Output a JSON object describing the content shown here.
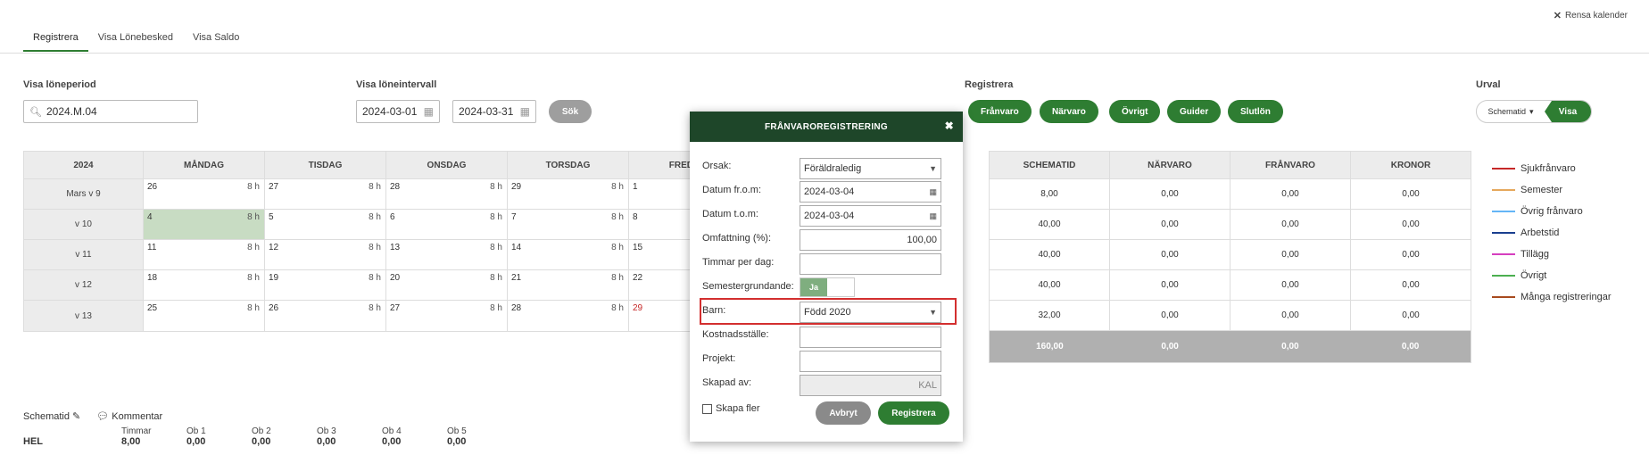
{
  "header": {
    "clear_calendar": "Rensa kalender"
  },
  "tabs": [
    "Registrera",
    "Visa Lönebesked",
    "Visa Saldo"
  ],
  "period": {
    "label": "Visa löneperiod",
    "value": "2024.M.04"
  },
  "interval": {
    "label": "Visa löneintervall",
    "from": "2024-03-01",
    "to": "2024-03-31",
    "search": "Sök"
  },
  "register": {
    "label": "Registrera",
    "buttons": [
      "Frånvaro",
      "Närvaro",
      "Övrigt",
      "Guider",
      "Slutlön"
    ]
  },
  "urval": {
    "label": "Urval",
    "select": "Schematid",
    "button": "Visa"
  },
  "calendar": {
    "year": "2024",
    "days": [
      "MÅNDAG",
      "TISDAG",
      "ONSDAG",
      "TORSDAG",
      "FRED"
    ],
    "rows": [
      {
        "week": "Mars v 9",
        "dates": [
          "26",
          "27",
          "28",
          "29",
          "1"
        ]
      },
      {
        "week": "v 10",
        "dates": [
          "4",
          "5",
          "6",
          "7",
          "8"
        ]
      },
      {
        "week": "v 11",
        "dates": [
          "11",
          "12",
          "13",
          "14",
          "15"
        ]
      },
      {
        "week": "v 12",
        "dates": [
          "18",
          "19",
          "20",
          "21",
          "22"
        ]
      },
      {
        "week": "v 13",
        "dates": [
          "25",
          "26",
          "27",
          "28",
          "29"
        ]
      }
    ],
    "hours": "8 h"
  },
  "summary": {
    "headers": [
      "SCHEMATID",
      "NÄRVARO",
      "FRÅNVARO",
      "KRONOR"
    ],
    "rows": [
      [
        "8,00",
        "0,00",
        "0,00",
        "0,00"
      ],
      [
        "40,00",
        "0,00",
        "0,00",
        "0,00"
      ],
      [
        "40,00",
        "0,00",
        "0,00",
        "0,00"
      ],
      [
        "40,00",
        "0,00",
        "0,00",
        "0,00"
      ],
      [
        "32,00",
        "0,00",
        "0,00",
        "0,00"
      ]
    ],
    "totals": [
      "160,00",
      "0,00",
      "0,00",
      "0,00"
    ]
  },
  "legend": [
    {
      "label": "Sjukfrånvaro",
      "color": "#c62828"
    },
    {
      "label": "Semester",
      "color": "#e6a85c"
    },
    {
      "label": "Övrig frånvaro",
      "color": "#64b5f6"
    },
    {
      "label": "Arbetstid",
      "color": "#1a3f8f"
    },
    {
      "label": "Tillägg",
      "color": "#d63fbf"
    },
    {
      "label": "Övrigt",
      "color": "#4caf50"
    },
    {
      "label": "Många registreringar",
      "color": "#a84a1e"
    }
  ],
  "bottom": {
    "schematid": "Schematid",
    "kommentar": "Kommentar",
    "row_label": "HEL",
    "cols": [
      {
        "title": "Timmar",
        "value": "8,00"
      },
      {
        "title": "Ob 1",
        "value": "0,00"
      },
      {
        "title": "Ob 2",
        "value": "0,00"
      },
      {
        "title": "Ob 3",
        "value": "0,00"
      },
      {
        "title": "Ob 4",
        "value": "0,00"
      },
      {
        "title": "Ob 5",
        "value": "0,00"
      }
    ]
  },
  "modal": {
    "title": "FRÅNVAROREGISTRERING",
    "orsak_label": "Orsak:",
    "orsak_value": "Föräldraledig",
    "from_label": "Datum fr.o.m:",
    "from_value": "2024-03-04",
    "to_label": "Datum t.o.m:",
    "to_value": "2024-03-04",
    "omf_label": "Omfattning (%):",
    "omf_value": "100,00",
    "timmar_label": "Timmar per dag:",
    "timmar_value": "",
    "sem_label": "Semestergrundande:",
    "sem_value": "Ja",
    "barn_label": "Barn:",
    "barn_value": "Född 2020",
    "kost_label": "Kostnadsställe:",
    "proj_label": "Projekt:",
    "skapad_label": "Skapad av:",
    "skapad_value": "KAL",
    "skapa_fler": "Skapa fler",
    "cancel": "Avbryt",
    "submit": "Registrera"
  }
}
